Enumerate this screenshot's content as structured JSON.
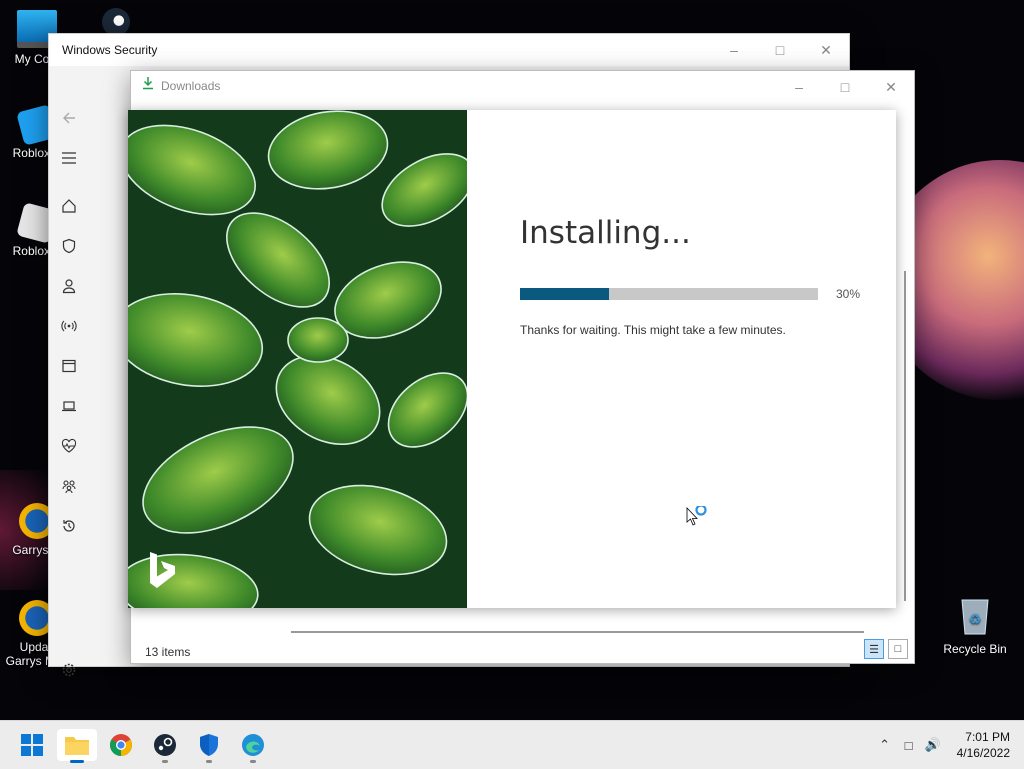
{
  "desktop": {
    "icons": [
      {
        "label": "My Com"
      },
      {
        "label": "Roblox S"
      },
      {
        "label": "Roblox P"
      },
      {
        "label": "Garrys M"
      },
      {
        "label": "Updati Garrys Mod"
      },
      {
        "label": "Recycle Bin"
      }
    ]
  },
  "windows_security": {
    "title": "Windows Security",
    "nav_icons": [
      "back-arrow-icon",
      "hamburger-icon",
      "home-icon",
      "shield-icon",
      "person-icon",
      "wireless-icon",
      "app-browser-icon",
      "laptop-icon",
      "heartbeat-icon",
      "family-icon",
      "history-icon",
      "settings-icon"
    ]
  },
  "downloads": {
    "title": "Downloads",
    "status": "13 items"
  },
  "installer": {
    "heading": "Installing...",
    "progress": 0.3,
    "progress_label": "30%",
    "message": "Thanks for waiting. This might take a few minutes."
  },
  "taskbar": {
    "apps": [
      "windows-start",
      "file-explorer",
      "chrome",
      "steam",
      "windows-security",
      "edge"
    ],
    "time": "7:01 PM",
    "date": "4/16/2022"
  },
  "colors": {
    "progress_fill": "#0a5a80",
    "progress_track": "#c8c8c8",
    "accent": "#0067c0"
  }
}
